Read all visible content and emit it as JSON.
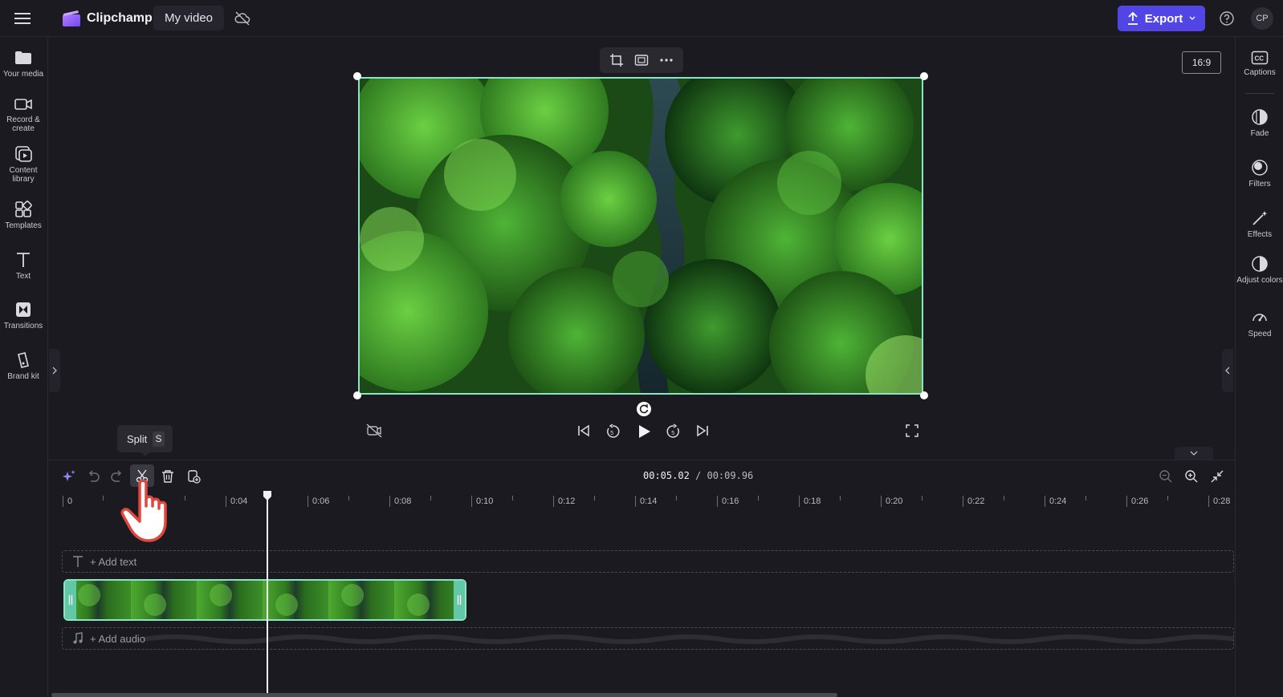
{
  "app": {
    "name": "Clipchamp",
    "project_name": "My video",
    "export_label": "Export",
    "avatar_initials": "CP",
    "accent_color": "#5146e5",
    "selection_color": "#8fe3c5"
  },
  "left_sidebar": {
    "items": [
      {
        "label": "Your media",
        "icon": "folder-icon"
      },
      {
        "label": "Record & create",
        "icon": "camera-icon"
      },
      {
        "label": "Content library",
        "icon": "library-icon"
      },
      {
        "label": "Templates",
        "icon": "templates-icon"
      },
      {
        "label": "Text",
        "icon": "text-icon"
      },
      {
        "label": "Transitions",
        "icon": "transitions-icon"
      },
      {
        "label": "Brand kit",
        "icon": "brand-kit-icon"
      }
    ]
  },
  "right_sidebar": {
    "items": [
      {
        "label": "Captions",
        "icon": "captions-icon"
      },
      {
        "label": "Fade",
        "icon": "fade-icon"
      },
      {
        "label": "Filters",
        "icon": "filters-icon"
      },
      {
        "label": "Effects",
        "icon": "effects-icon"
      },
      {
        "label": "Adjust colors",
        "icon": "adjust-colors-icon"
      },
      {
        "label": "Speed",
        "icon": "speed-icon"
      }
    ]
  },
  "preview": {
    "aspect_ratio": "16:9"
  },
  "timeline": {
    "current_time": "00:05.02",
    "separator": " / ",
    "total_time": "00:09.96",
    "tooltip_label": "Split",
    "tooltip_key": "S",
    "ruler_labels": [
      "0",
      "0:04",
      "0:06",
      "0:08",
      "0:10",
      "0:12",
      "0:14",
      "0:16",
      "0:18",
      "0:20",
      "0:22",
      "0:24",
      "0:26",
      "0:28"
    ],
    "add_text_label": "+ Add text",
    "add_audio_label": "+ Add audio"
  }
}
